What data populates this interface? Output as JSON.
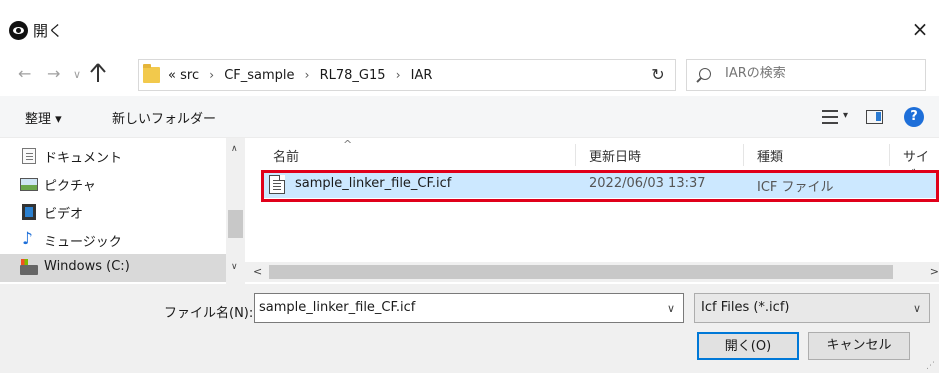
{
  "window": {
    "title": "開く",
    "close_symbol": "×"
  },
  "nav": {
    "back": "←",
    "forward": "→",
    "recent": "∨",
    "up": "↑"
  },
  "address": {
    "prefix": "«",
    "crumbs": [
      "src",
      "CF_sample",
      "RL78_G15",
      "IAR"
    ],
    "separator": "›",
    "dropdown": "∨",
    "refresh": "↻"
  },
  "search": {
    "placeholder": "IARの検索"
  },
  "toolbar": {
    "organize_label": "整理 ▾",
    "new_folder_label": "新しいフォルダー",
    "view_caret": "▾",
    "help_label": "?"
  },
  "navpane": {
    "items": [
      {
        "label": "ドキュメント",
        "icon": "document-icon"
      },
      {
        "label": "ピクチャ",
        "icon": "pictures-icon"
      },
      {
        "label": "ビデオ",
        "icon": "video-icon"
      },
      {
        "label": "ミュージック",
        "icon": "music-icon"
      },
      {
        "label": "Windows (C:)",
        "icon": "drive-icon",
        "selected": true
      }
    ],
    "scroll_up": "∧",
    "scroll_down": "∨"
  },
  "filelist": {
    "sort_indicator": "^",
    "columns": [
      "名前",
      "更新日時",
      "種類",
      "サイズ"
    ],
    "rows": [
      {
        "name": "sample_linker_file_CF.icf",
        "date": "2022/06/03 13:37",
        "type": "ICF ファイル"
      }
    ],
    "hscroll_left": "<",
    "hscroll_right": ">"
  },
  "bottom": {
    "filename_label": "ファイル名(N):",
    "filename_value": "sample_linker_file_CF.icf",
    "dropdown_caret": "∨",
    "filter_value": "Icf Files (*.icf)",
    "open_label": "開く(O)",
    "cancel_label": "キャンセル",
    "grip": "⋰"
  },
  "colors": {
    "accent": "#0078d7",
    "highlight": "#e0001a",
    "selection": "#cce8ff"
  }
}
